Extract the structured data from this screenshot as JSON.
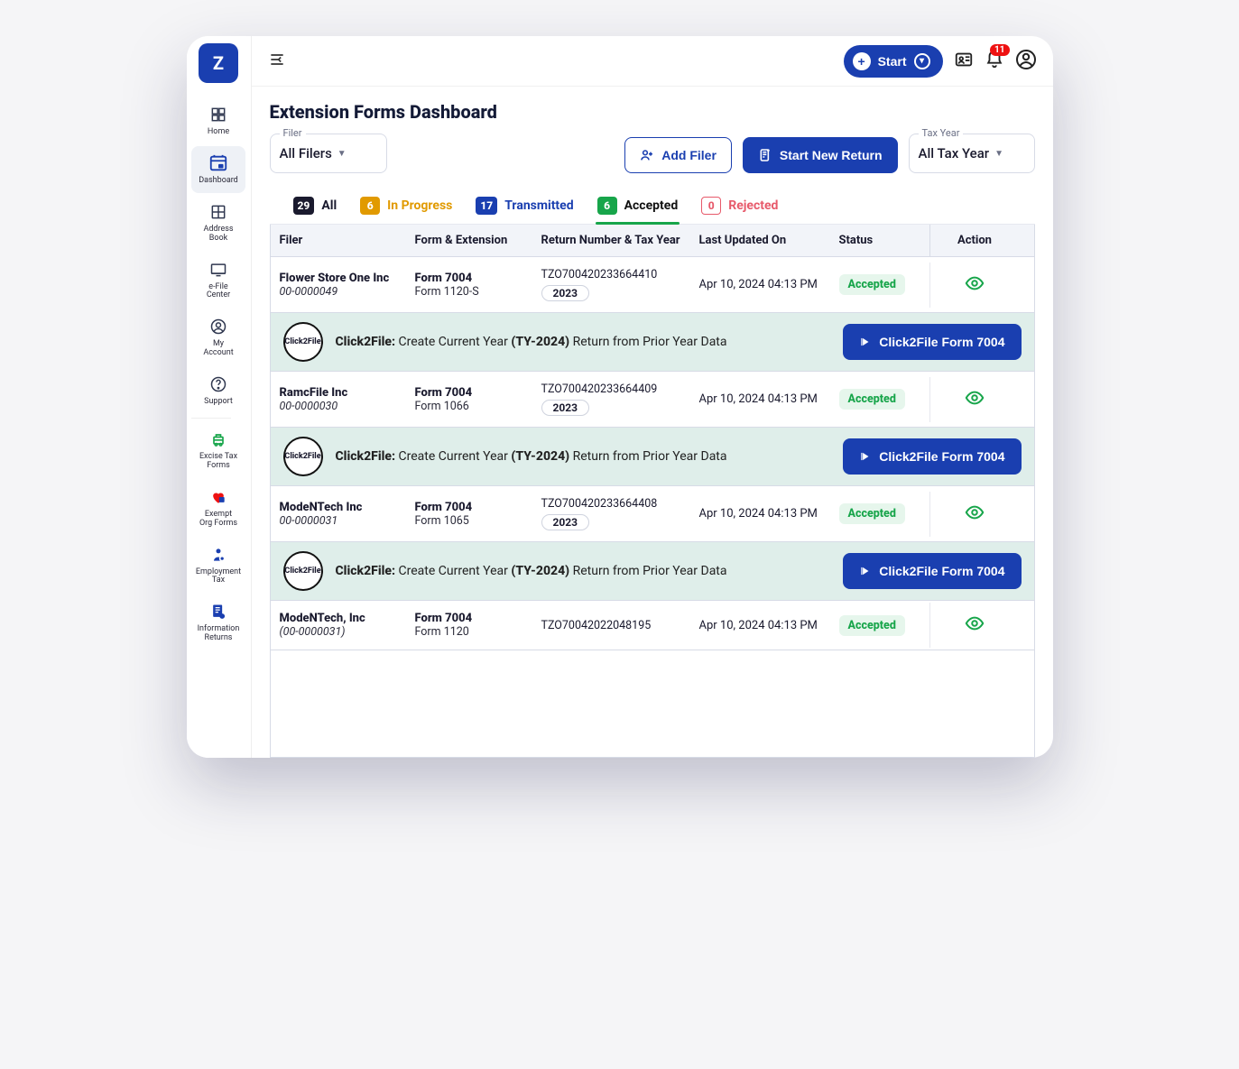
{
  "brand": {
    "glyph": "Z"
  },
  "topbar": {
    "start_label": "Start",
    "notifications_count": "11"
  },
  "page": {
    "title": "Extension Forms Dashboard"
  },
  "filters": {
    "filer": {
      "legend": "Filer",
      "value": "All Filers"
    },
    "tax_year": {
      "legend": "Tax Year",
      "value": "All Tax Year"
    },
    "add_filer_label": "Add Filer",
    "start_new_return_label": "Start New Return"
  },
  "sidebar": {
    "items": [
      {
        "id": "home",
        "label": "Home"
      },
      {
        "id": "dashboard",
        "label": "Dashboard",
        "active": true
      },
      {
        "id": "address-book",
        "label": "Address\nBook"
      },
      {
        "id": "efile-center",
        "label": "e-File\nCenter"
      },
      {
        "id": "my-account",
        "label": "My\nAccount"
      },
      {
        "id": "support",
        "label": "Support"
      },
      {
        "id": "excise-tax-forms",
        "label": "Excise Tax\nForms"
      },
      {
        "id": "exempt-org-forms",
        "label": "Exempt\nOrg Forms"
      },
      {
        "id": "employment-tax",
        "label": "Employment\nTax"
      },
      {
        "id": "information-returns",
        "label": "Information\nReturns"
      }
    ]
  },
  "tabs": [
    {
      "id": "all",
      "label": "All",
      "count": "29",
      "color": "#1a1a2e",
      "text_color": "#1a1a2e"
    },
    {
      "id": "in-progress",
      "label": "In Progress",
      "count": "6",
      "color": "#e19a00",
      "text_color": "#e19a00"
    },
    {
      "id": "transmitted",
      "label": "Transmitted",
      "count": "17",
      "color": "#1a3fb0",
      "text_color": "#1a3fb0"
    },
    {
      "id": "accepted",
      "label": "Accepted",
      "count": "6",
      "color": "#17a54a",
      "text_color": "#111",
      "active": true
    },
    {
      "id": "rejected",
      "label": "Rejected",
      "count": "0",
      "color": "#e75a6b",
      "text_color": "#e75a6b",
      "outline": true
    }
  ],
  "columns": {
    "filer": "Filer",
    "form": "Form & Extension",
    "return": "Return Number & Tax Year",
    "updated": "Last Updated On",
    "status": "Status",
    "action": "Action"
  },
  "click2file": {
    "badge_text": "Click2File",
    "prefix": "Click2File:",
    "msg_pre": " Create Current Year ",
    "ty": "(TY-2024)",
    "msg_post": " Return from Prior Year Data",
    "button_label": "Click2File Form 7004"
  },
  "rows": [
    {
      "filer_name": "Flower Store One Inc",
      "ein": "00-0000049",
      "form": "Form 7004",
      "extension": "Form 1120-S",
      "return_number": "TZO700420233664410",
      "tax_year": "2023",
      "updated": "Apr 10, 2024 04:13 PM",
      "status": "Accepted",
      "banner": true
    },
    {
      "filer_name": "RamcFile Inc",
      "ein": "00-0000030",
      "form": "Form 7004",
      "extension": "Form 1066",
      "return_number": "TZO700420233664409",
      "tax_year": "2023",
      "updated": "Apr 10, 2024 04:13 PM",
      "status": "Accepted",
      "banner": true
    },
    {
      "filer_name": "ModeNTech Inc",
      "ein": "00-0000031",
      "form": "Form 7004",
      "extension": "Form 1065",
      "return_number": "TZO700420233664408",
      "tax_year": "2023",
      "updated": "Apr 10, 2024 04:13 PM",
      "status": "Accepted",
      "banner": true
    },
    {
      "filer_name": "ModeNTech, Inc",
      "ein": "(00-0000031)",
      "form": "Form 7004",
      "extension": "Form 1120",
      "return_number": "TZO70042022048195",
      "tax_year": "",
      "updated": "Apr 10, 2024 04:13 PM",
      "status": "Accepted",
      "banner": false
    }
  ]
}
